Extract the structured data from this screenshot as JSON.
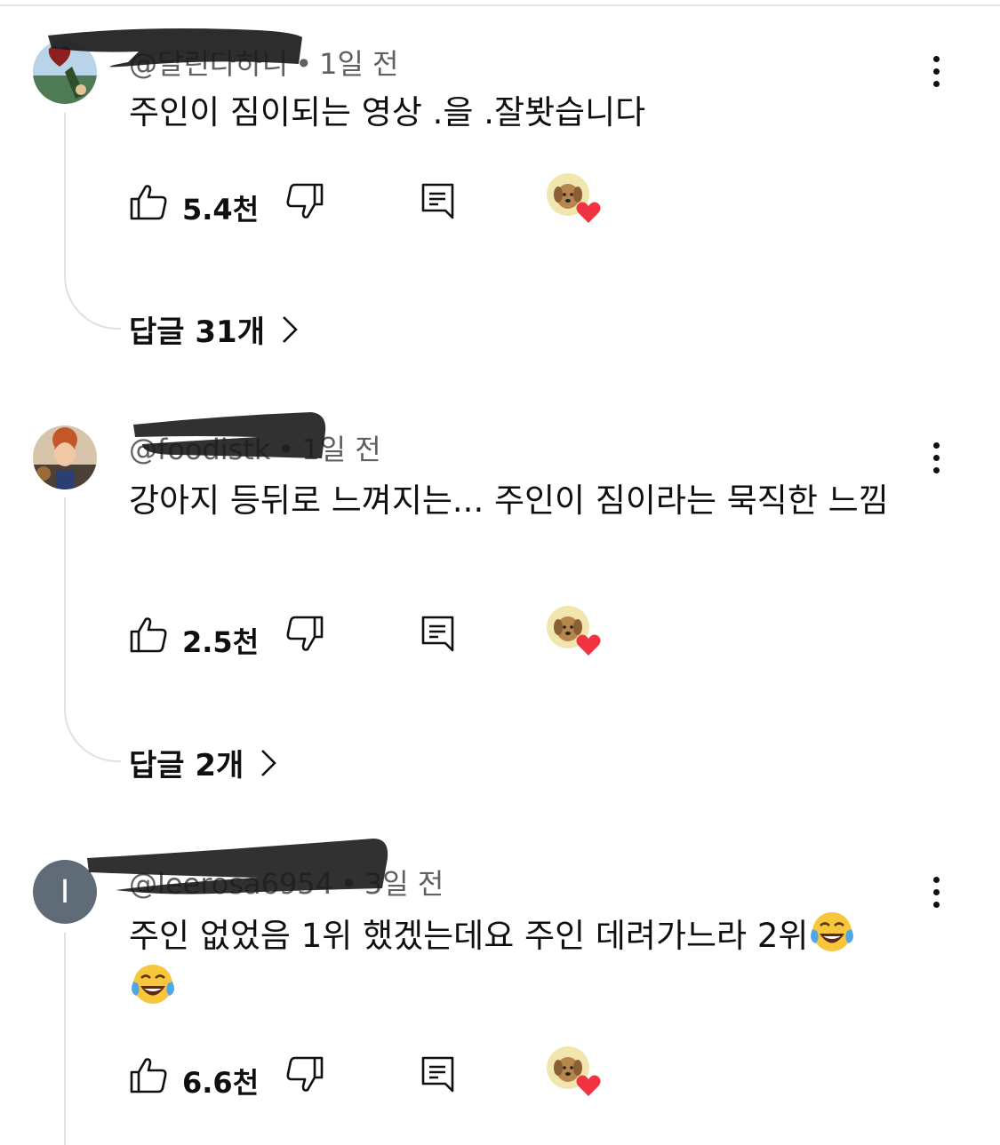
{
  "comments": [
    {
      "handle": "@달린다하니",
      "dot": "•",
      "time": "1일 전",
      "text": "주인이 짐이되는 영상 .을  .잘봣습니다",
      "likes": "5.4천",
      "replies": "답글 31개",
      "avatar": "photo"
    },
    {
      "handle": "@foodistk",
      "dot": "•",
      "time": "1일 전",
      "text": "강아지 등뒤로 느껴지는... 주인이 짐이라는 묵직한 느낌",
      "likes": "2.5천",
      "replies": "답글 2개",
      "avatar": "photo"
    },
    {
      "handle": "@leerosa6954",
      "dot": "•",
      "time": "3일 전",
      "text": "주인 없었음 1위 했겠는데요 주인 데려가느라 2위",
      "text_emoji": "face-with-tears-of-joy",
      "likes": "6.6천",
      "avatar_letter": "I"
    }
  ],
  "icons": {
    "like": "thumbs-up-icon",
    "dislike": "thumbs-down-icon",
    "reply": "reply-icon",
    "creator_heart": "creator-heart-icon",
    "menu": "more-vertical-icon",
    "chevron": "chevron-right-icon"
  },
  "colors": {
    "heart": "#ef3340",
    "meta_text": "#606060",
    "avatar_letter_bg": "#5f6b76"
  }
}
